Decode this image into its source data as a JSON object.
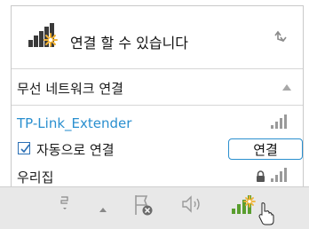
{
  "header": {
    "status": "연결 할 수 있습니다",
    "network_icon": "network-connections-available-icon",
    "refresh_icon": "refresh-icon"
  },
  "section": {
    "title": "무선 네트워크 연결",
    "collapse_icon": "chevron-up-icon"
  },
  "networks": [
    {
      "ssid": "TP-Link_Extender",
      "selected": true,
      "secured": false,
      "signal_bars": 4,
      "auto_connect_label": "자동으로 연결",
      "auto_connect_checked": true,
      "connect_label": "연결"
    },
    {
      "ssid": "우리집",
      "selected": false,
      "secured": true,
      "signal_bars": 4
    }
  ],
  "taskbar": {
    "icons": [
      "keyboard-layout-icon",
      "show-hidden-icons-arrow",
      "action-center-flag-icon",
      "speaker-icon",
      "wifi-network-icon"
    ]
  },
  "colors": {
    "accent": "#2a8fcf",
    "signal": "#5a9e2f",
    "taskbar_bg": "#e8e8e8"
  }
}
